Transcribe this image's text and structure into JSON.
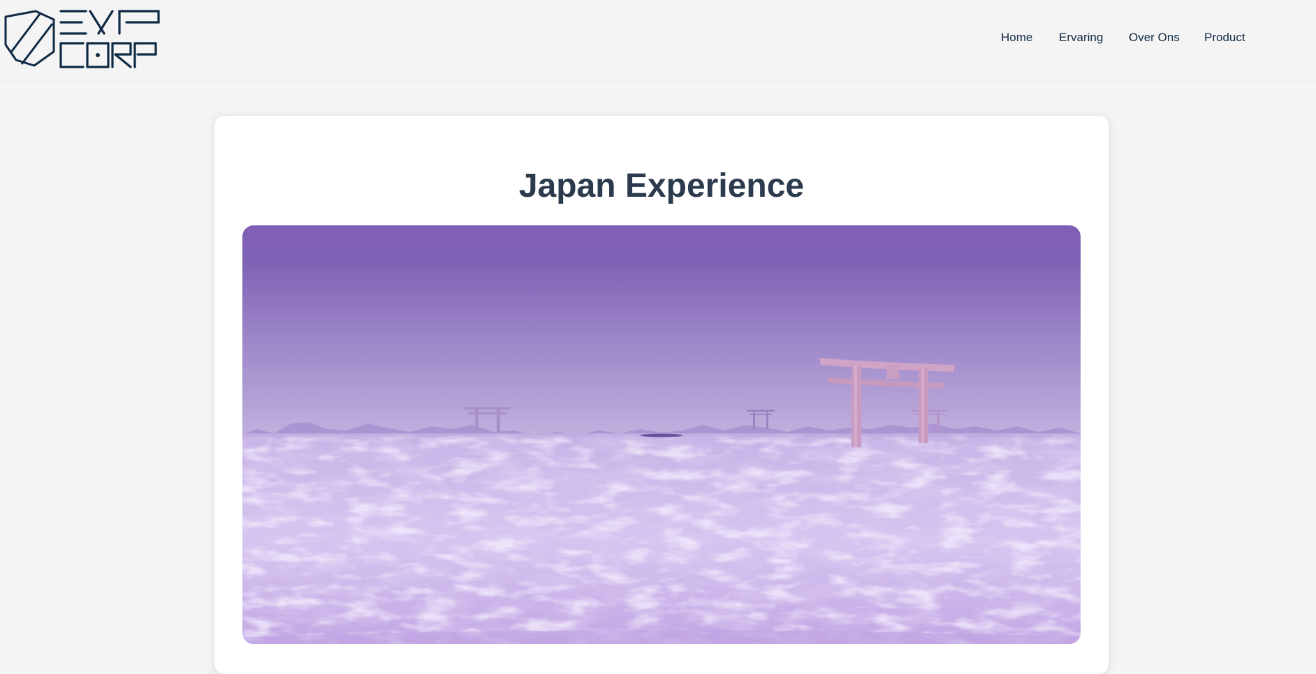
{
  "header": {
    "logo": {
      "text_top": "EXP",
      "text_bottom": "CORP",
      "icon": "shield-icon"
    },
    "nav": [
      {
        "label": "Home"
      },
      {
        "label": "Ervaring"
      },
      {
        "label": "Over Ons"
      },
      {
        "label": "Product"
      }
    ]
  },
  "main": {
    "title": "Japan Experience",
    "scene": {
      "description_icon": "panorama-viewer",
      "colors": {
        "sky_top": "#7f5fb5",
        "sky_horizon": "#b8a6d8",
        "ground_light": "#e4d9f6",
        "ground_dark": "#bba0dd",
        "torii": "#c99bbf"
      }
    }
  }
}
